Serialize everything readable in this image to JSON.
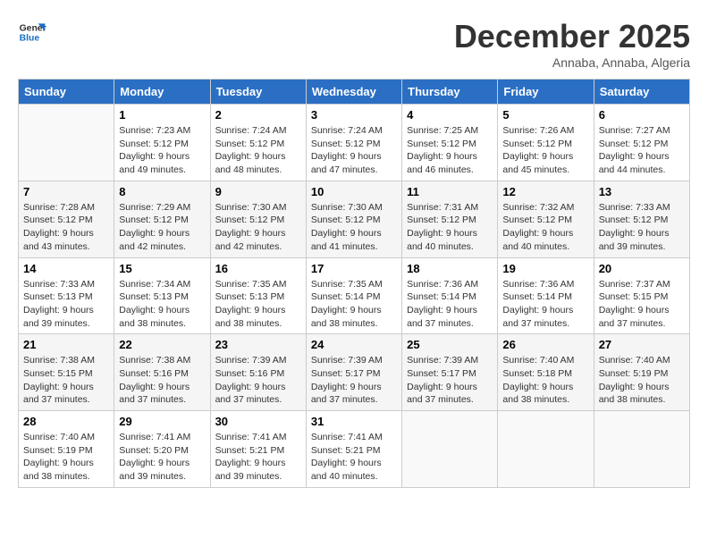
{
  "logo": {
    "line1": "General",
    "line2": "Blue"
  },
  "title": "December 2025",
  "subtitle": "Annaba, Annaba, Algeria",
  "headers": [
    "Sunday",
    "Monday",
    "Tuesday",
    "Wednesday",
    "Thursday",
    "Friday",
    "Saturday"
  ],
  "weeks": [
    [
      {
        "num": "",
        "info": ""
      },
      {
        "num": "1",
        "info": "Sunrise: 7:23 AM\nSunset: 5:12 PM\nDaylight: 9 hours\nand 49 minutes."
      },
      {
        "num": "2",
        "info": "Sunrise: 7:24 AM\nSunset: 5:12 PM\nDaylight: 9 hours\nand 48 minutes."
      },
      {
        "num": "3",
        "info": "Sunrise: 7:24 AM\nSunset: 5:12 PM\nDaylight: 9 hours\nand 47 minutes."
      },
      {
        "num": "4",
        "info": "Sunrise: 7:25 AM\nSunset: 5:12 PM\nDaylight: 9 hours\nand 46 minutes."
      },
      {
        "num": "5",
        "info": "Sunrise: 7:26 AM\nSunset: 5:12 PM\nDaylight: 9 hours\nand 45 minutes."
      },
      {
        "num": "6",
        "info": "Sunrise: 7:27 AM\nSunset: 5:12 PM\nDaylight: 9 hours\nand 44 minutes."
      }
    ],
    [
      {
        "num": "7",
        "info": "Sunrise: 7:28 AM\nSunset: 5:12 PM\nDaylight: 9 hours\nand 43 minutes."
      },
      {
        "num": "8",
        "info": "Sunrise: 7:29 AM\nSunset: 5:12 PM\nDaylight: 9 hours\nand 42 minutes."
      },
      {
        "num": "9",
        "info": "Sunrise: 7:30 AM\nSunset: 5:12 PM\nDaylight: 9 hours\nand 42 minutes."
      },
      {
        "num": "10",
        "info": "Sunrise: 7:30 AM\nSunset: 5:12 PM\nDaylight: 9 hours\nand 41 minutes."
      },
      {
        "num": "11",
        "info": "Sunrise: 7:31 AM\nSunset: 5:12 PM\nDaylight: 9 hours\nand 40 minutes."
      },
      {
        "num": "12",
        "info": "Sunrise: 7:32 AM\nSunset: 5:12 PM\nDaylight: 9 hours\nand 40 minutes."
      },
      {
        "num": "13",
        "info": "Sunrise: 7:33 AM\nSunset: 5:12 PM\nDaylight: 9 hours\nand 39 minutes."
      }
    ],
    [
      {
        "num": "14",
        "info": "Sunrise: 7:33 AM\nSunset: 5:13 PM\nDaylight: 9 hours\nand 39 minutes."
      },
      {
        "num": "15",
        "info": "Sunrise: 7:34 AM\nSunset: 5:13 PM\nDaylight: 9 hours\nand 38 minutes."
      },
      {
        "num": "16",
        "info": "Sunrise: 7:35 AM\nSunset: 5:13 PM\nDaylight: 9 hours\nand 38 minutes."
      },
      {
        "num": "17",
        "info": "Sunrise: 7:35 AM\nSunset: 5:14 PM\nDaylight: 9 hours\nand 38 minutes."
      },
      {
        "num": "18",
        "info": "Sunrise: 7:36 AM\nSunset: 5:14 PM\nDaylight: 9 hours\nand 37 minutes."
      },
      {
        "num": "19",
        "info": "Sunrise: 7:36 AM\nSunset: 5:14 PM\nDaylight: 9 hours\nand 37 minutes."
      },
      {
        "num": "20",
        "info": "Sunrise: 7:37 AM\nSunset: 5:15 PM\nDaylight: 9 hours\nand 37 minutes."
      }
    ],
    [
      {
        "num": "21",
        "info": "Sunrise: 7:38 AM\nSunset: 5:15 PM\nDaylight: 9 hours\nand 37 minutes."
      },
      {
        "num": "22",
        "info": "Sunrise: 7:38 AM\nSunset: 5:16 PM\nDaylight: 9 hours\nand 37 minutes."
      },
      {
        "num": "23",
        "info": "Sunrise: 7:39 AM\nSunset: 5:16 PM\nDaylight: 9 hours\nand 37 minutes."
      },
      {
        "num": "24",
        "info": "Sunrise: 7:39 AM\nSunset: 5:17 PM\nDaylight: 9 hours\nand 37 minutes."
      },
      {
        "num": "25",
        "info": "Sunrise: 7:39 AM\nSunset: 5:17 PM\nDaylight: 9 hours\nand 37 minutes."
      },
      {
        "num": "26",
        "info": "Sunrise: 7:40 AM\nSunset: 5:18 PM\nDaylight: 9 hours\nand 38 minutes."
      },
      {
        "num": "27",
        "info": "Sunrise: 7:40 AM\nSunset: 5:19 PM\nDaylight: 9 hours\nand 38 minutes."
      }
    ],
    [
      {
        "num": "28",
        "info": "Sunrise: 7:40 AM\nSunset: 5:19 PM\nDaylight: 9 hours\nand 38 minutes."
      },
      {
        "num": "29",
        "info": "Sunrise: 7:41 AM\nSunset: 5:20 PM\nDaylight: 9 hours\nand 39 minutes."
      },
      {
        "num": "30",
        "info": "Sunrise: 7:41 AM\nSunset: 5:21 PM\nDaylight: 9 hours\nand 39 minutes."
      },
      {
        "num": "31",
        "info": "Sunrise: 7:41 AM\nSunset: 5:21 PM\nDaylight: 9 hours\nand 40 minutes."
      },
      {
        "num": "",
        "info": ""
      },
      {
        "num": "",
        "info": ""
      },
      {
        "num": "",
        "info": ""
      }
    ]
  ]
}
